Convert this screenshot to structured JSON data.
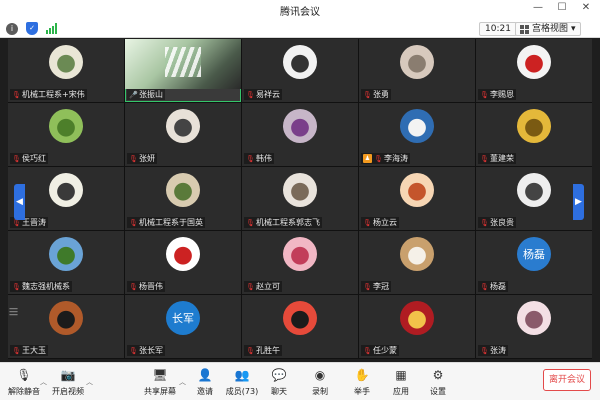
{
  "window": {
    "title": "腾讯会议"
  },
  "topbar": {
    "time": "10:21",
    "view_label": "宫格视图"
  },
  "participants": [
    {
      "name": "机械工程系+宋伟",
      "muted": true,
      "bg": "#e9e6d6",
      "fg": "#6b8a54"
    },
    {
      "name": "张振山",
      "muted": false,
      "video": true
    },
    {
      "name": "易祥云",
      "muted": true,
      "bg": "#f2f2f2",
      "fg": "#333"
    },
    {
      "name": "张勇",
      "muted": true,
      "bg": "#d7c9bd",
      "fg": "#8a7d70"
    },
    {
      "name": "李赐恩",
      "muted": true,
      "bg": "#f4f4f4",
      "fg": "#c22"
    },
    {
      "name": "侯巧红",
      "muted": true,
      "bg": "#8fbf5a",
      "fg": "#4d7f2a"
    },
    {
      "name": "张妍",
      "muted": true,
      "bg": "#e8e1d8",
      "fg": "#444"
    },
    {
      "name": "韩伟",
      "muted": true,
      "bg": "#c7b6c8",
      "fg": "#7a3f8a"
    },
    {
      "name": "李海涛",
      "muted": true,
      "host": true,
      "bg": "#2f6db3",
      "fg": "#f3f3f3"
    },
    {
      "name": "董建荣",
      "muted": true,
      "bg": "#e4b83a",
      "fg": "#7a5a12"
    },
    {
      "name": "王晋涛",
      "muted": true,
      "bg": "#f0efe4",
      "fg": "#3a3a3a"
    },
    {
      "name": "机械工程系于国英",
      "muted": true,
      "bg": "#d8cbb0",
      "fg": "#5a7a3a"
    },
    {
      "name": "机械工程系郭志飞",
      "muted": true,
      "bg": "#e9e3dc",
      "fg": "#7a6a5a"
    },
    {
      "name": "杨立云",
      "muted": true,
      "bg": "#f6d6b4",
      "fg": "#c4552c"
    },
    {
      "name": "张良贵",
      "muted": true,
      "bg": "#eeeeee",
      "fg": "#444"
    },
    {
      "name": "魏志强机械系",
      "muted": true,
      "bg": "#6aa3d6",
      "fg": "#3f7a2a"
    },
    {
      "name": "杨晋伟",
      "muted": true,
      "bg": "#ffffff",
      "fg": "#c22"
    },
    {
      "name": "赵立可",
      "muted": true,
      "bg": "#f1b7c4",
      "fg": "#c23d5a"
    },
    {
      "name": "李冠",
      "muted": true,
      "bg": "#c9a06d",
      "fg": "#f5f0e8"
    },
    {
      "name": "杨磊",
      "muted": true,
      "bg": "#2a7ccf",
      "fg": "#ffffff",
      "text": "杨磊"
    },
    {
      "name": "王大玉",
      "muted": true,
      "bg": "#b05a2a",
      "fg": "#1b1b1b"
    },
    {
      "name": "张长军",
      "muted": true,
      "bg": "#1e7ccf",
      "fg": "#ffffff",
      "text": "长军"
    },
    {
      "name": "孔胜午",
      "muted": true,
      "bg": "#e64a3a",
      "fg": "#1b1b1b"
    },
    {
      "name": "任少蒙",
      "muted": true,
      "bg": "#b01c22",
      "fg": "#f2c24a"
    },
    {
      "name": "张涛",
      "muted": true,
      "bg": "#f3dfe4",
      "fg": "#8a5a6a"
    }
  ],
  "toolbar": {
    "mute": "解除静音",
    "video": "开启视频",
    "share": "共享屏幕",
    "invite": "邀请",
    "members": "成员(73)",
    "chat": "聊天",
    "record": "录制",
    "raise": "举手",
    "apps": "应用",
    "settings": "设置",
    "leave": "离开会议"
  }
}
